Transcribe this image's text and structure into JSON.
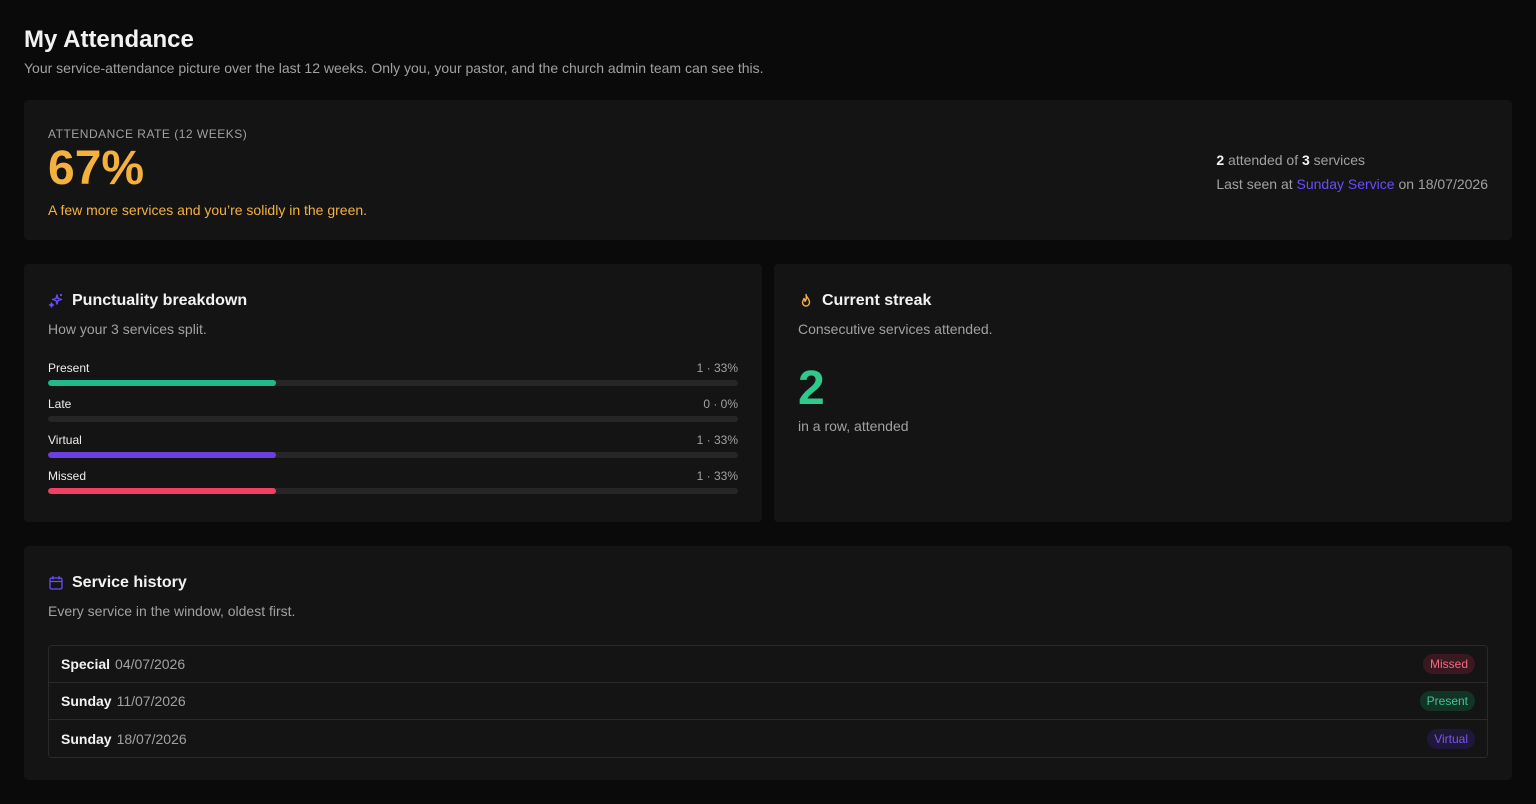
{
  "header": {
    "title": "My Attendance",
    "subtitle": "Your service-attendance picture over the last 12 weeks. Only you, your pastor, and the church admin team can see this."
  },
  "rate": {
    "label": "ATTENDANCE RATE (12 WEEKS)",
    "value": "67%",
    "message": "A few more services and you’re solidly in the green.",
    "attended": "2",
    "attended_text": "attended of",
    "total": "3",
    "total_text": "services",
    "last_seen_prefix": "Last seen at",
    "last_seen_service": "Sunday Service",
    "last_seen_suffix": "on 18/07/2026",
    "accent": "#f5b13d"
  },
  "punctuality": {
    "icon": "sparkles-icon",
    "title": "Punctuality breakdown",
    "description": "How your 3 services split.",
    "items": [
      {
        "name": "Present",
        "count": "1 · 33%",
        "fraction": 0.33,
        "color": "#1fb98a"
      },
      {
        "name": "Late",
        "count": "0 · 0%",
        "fraction": 0,
        "color": "#f5b13d"
      },
      {
        "name": "Virtual",
        "count": "1 · 33%",
        "fraction": 0.33,
        "color": "#6c3fe0"
      },
      {
        "name": "Missed",
        "count": "1 · 33%",
        "fraction": 0.33,
        "color": "#f23f63"
      }
    ]
  },
  "streak": {
    "icon": "flame-icon",
    "title": "Current streak",
    "description": "Consecutive services attended.",
    "value": "2",
    "caption": "in a row, attended",
    "color": "#2ec98b"
  },
  "history": {
    "icon": "calendar-icon",
    "title": "Service history",
    "description": "Every service in the window, oldest first.",
    "rows": [
      {
        "type": "Special",
        "date": "04/07/2026",
        "status": "Missed",
        "fg": "#f16a84",
        "bg": "#3a1820"
      },
      {
        "type": "Sunday",
        "date": "11/07/2026",
        "status": "Present",
        "fg": "#39c996",
        "bg": "#123326"
      },
      {
        "type": "Sunday",
        "date": "18/07/2026",
        "status": "Virtual",
        "fg": "#7a57f0",
        "bg": "#1f1838"
      }
    ]
  }
}
